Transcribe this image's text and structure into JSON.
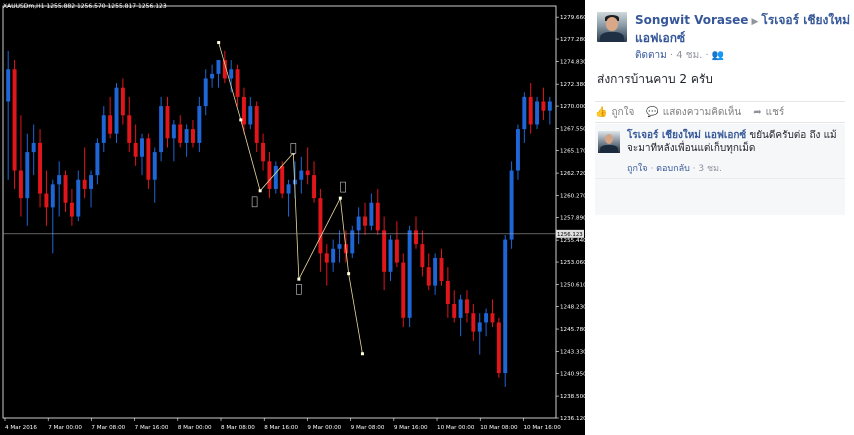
{
  "chart": {
    "header": "XAUUSDm,H1  1255.882 1256.570 1255.817 1256.123",
    "current_price": "1256.123",
    "price_labels": [
      "1279.660",
      "1277.280",
      "1274.830",
      "1272.380",
      "1270.000",
      "1267.550",
      "1265.170",
      "1262.720",
      "1260.270",
      "1257.890",
      "1255.440",
      "1253.060",
      "1250.610",
      "1248.230",
      "1245.780",
      "1243.330",
      "1240.950",
      "1238.500",
      "1236.120"
    ],
    "time_labels": [
      "4 Mar 2016",
      "7 Mar 00:00",
      "7 Mar 08:00",
      "7 Mar 16:00",
      "8 Mar 00:00",
      "8 Mar 08:00",
      "8 Mar 16:00",
      "9 Mar 00:00",
      "9 Mar 08:00",
      "9 Mar 16:00",
      "10 Mar 00:00",
      "10 Mar 08:00",
      "10 Mar 16:00"
    ],
    "colors": {
      "bull": "#1e66d6",
      "bear": "#e0161b",
      "background": "#000000",
      "axis": "#ffffff",
      "zigzag": "#e8d7a0"
    },
    "ylim": [
      1236.12,
      1280.87
    ],
    "candles": [
      [
        1270.5,
        1276.0,
        1262.0,
        1274.0
      ],
      [
        1274.0,
        1275.0,
        1261.0,
        1263.0
      ],
      [
        1263.0,
        1269.0,
        1258.0,
        1260.0
      ],
      [
        1260.0,
        1267.0,
        1257.0,
        1265.0
      ],
      [
        1265.0,
        1268.0,
        1262.5,
        1266.0
      ],
      [
        1266.0,
        1267.5,
        1259.0,
        1260.5
      ],
      [
        1260.5,
        1263.0,
        1257.0,
        1259.0
      ],
      [
        1259.0,
        1262.0,
        1254.0,
        1261.5
      ],
      [
        1261.5,
        1264.0,
        1258.0,
        1262.5
      ],
      [
        1262.5,
        1263.0,
        1258.5,
        1259.5
      ],
      [
        1259.5,
        1261.0,
        1257.0,
        1258.0
      ],
      [
        1258.0,
        1263.0,
        1257.5,
        1262.0
      ],
      [
        1262.0,
        1265.5,
        1260.0,
        1261.0
      ],
      [
        1261.0,
        1263.0,
        1259.0,
        1262.5
      ],
      [
        1262.5,
        1266.5,
        1261.5,
        1266.0
      ],
      [
        1266.0,
        1270.0,
        1265.0,
        1269.0
      ],
      [
        1269.0,
        1271.0,
        1266.5,
        1267.0
      ],
      [
        1267.0,
        1272.5,
        1266.0,
        1272.0
      ],
      [
        1272.0,
        1273.0,
        1268.0,
        1269.0
      ],
      [
        1269.0,
        1271.0,
        1265.0,
        1266.0
      ],
      [
        1266.0,
        1268.0,
        1263.5,
        1264.5
      ],
      [
        1264.5,
        1267.0,
        1262.5,
        1266.5
      ],
      [
        1266.5,
        1267.0,
        1261.0,
        1262.0
      ],
      [
        1262.0,
        1265.5,
        1259.5,
        1265.0
      ],
      [
        1265.0,
        1271.0,
        1264.0,
        1270.0
      ],
      [
        1270.0,
        1271.0,
        1265.5,
        1266.5
      ],
      [
        1266.5,
        1268.5,
        1264.0,
        1268.0
      ],
      [
        1268.0,
        1269.0,
        1265.5,
        1266.0
      ],
      [
        1266.0,
        1268.0,
        1264.5,
        1267.5
      ],
      [
        1267.5,
        1268.5,
        1265.5,
        1266.0
      ],
      [
        1266.0,
        1271.0,
        1265.0,
        1270.0
      ],
      [
        1270.0,
        1274.0,
        1269.0,
        1273.0
      ],
      [
        1273.0,
        1274.5,
        1272.0,
        1273.5
      ],
      [
        1273.5,
        1275.0,
        1272.0,
        1275.0
      ],
      [
        1275.0,
        1276.0,
        1272.5,
        1273.0
      ],
      [
        1273.0,
        1275.0,
        1271.5,
        1274.0
      ],
      [
        1274.0,
        1274.5,
        1270.0,
        1271.0
      ],
      [
        1271.0,
        1272.0,
        1267.0,
        1268.0
      ],
      [
        1268.0,
        1271.0,
        1267.5,
        1270.0
      ],
      [
        1270.0,
        1270.5,
        1265.0,
        1266.0
      ],
      [
        1266.0,
        1267.0,
        1263.0,
        1264.0
      ],
      [
        1264.0,
        1265.0,
        1260.0,
        1261.0
      ],
      [
        1261.0,
        1264.0,
        1260.5,
        1263.5
      ],
      [
        1263.5,
        1264.0,
        1260.0,
        1260.5
      ],
      [
        1260.5,
        1262.0,
        1258.0,
        1261.5
      ],
      [
        1261.5,
        1264.0,
        1260.0,
        1262.0
      ],
      [
        1262.0,
        1264.5,
        1260.5,
        1263.0
      ],
      [
        1263.0,
        1265.5,
        1261.5,
        1262.5
      ],
      [
        1262.5,
        1264.0,
        1259.5,
        1260.0
      ],
      [
        1260.0,
        1261.0,
        1252.0,
        1254.0
      ],
      [
        1254.0,
        1255.0,
        1250.5,
        1253.0
      ],
      [
        1253.0,
        1255.5,
        1252.0,
        1254.5
      ],
      [
        1254.5,
        1256.5,
        1253.0,
        1255.0
      ],
      [
        1255.0,
        1256.5,
        1253.0,
        1254.0
      ],
      [
        1254.0,
        1257.0,
        1253.5,
        1256.5
      ],
      [
        1256.5,
        1259.0,
        1255.0,
        1258.0
      ],
      [
        1258.0,
        1259.5,
        1256.0,
        1257.0
      ],
      [
        1257.0,
        1260.5,
        1256.5,
        1259.5
      ],
      [
        1259.5,
        1261.0,
        1256.0,
        1256.5
      ],
      [
        1256.5,
        1258.0,
        1250.0,
        1252.0
      ],
      [
        1252.0,
        1256.0,
        1251.0,
        1255.5
      ],
      [
        1255.5,
        1257.5,
        1252.5,
        1253.0
      ],
      [
        1253.0,
        1254.0,
        1246.0,
        1247.0
      ],
      [
        1247.0,
        1257.0,
        1246.0,
        1256.5
      ],
      [
        1256.5,
        1258.0,
        1254.5,
        1255.0
      ],
      [
        1255.0,
        1256.5,
        1251.5,
        1252.5
      ],
      [
        1252.5,
        1254.0,
        1250.0,
        1250.5
      ],
      [
        1250.5,
        1254.0,
        1249.5,
        1253.5
      ],
      [
        1253.5,
        1254.5,
        1250.5,
        1251.0
      ],
      [
        1251.0,
        1252.5,
        1247.0,
        1248.5
      ],
      [
        1248.5,
        1250.0,
        1246.5,
        1247.0
      ],
      [
        1247.0,
        1249.5,
        1245.0,
        1249.0
      ],
      [
        1249.0,
        1250.0,
        1246.5,
        1247.5
      ],
      [
        1247.5,
        1248.5,
        1244.5,
        1245.5
      ],
      [
        1245.5,
        1247.5,
        1243.0,
        1246.5
      ],
      [
        1246.5,
        1248.0,
        1245.0,
        1247.5
      ],
      [
        1247.5,
        1249.0,
        1246.0,
        1246.5
      ],
      [
        1246.5,
        1247.0,
        1240.5,
        1241.0
      ],
      [
        1241.0,
        1256.0,
        1239.5,
        1255.5
      ],
      [
        1255.5,
        1264.0,
        1254.5,
        1263.0
      ],
      [
        1263.0,
        1268.0,
        1262.0,
        1267.5
      ],
      [
        1267.5,
        1271.5,
        1266.0,
        1271.0
      ],
      [
        1271.0,
        1272.5,
        1267.0,
        1268.0
      ],
      [
        1268.0,
        1271.0,
        1267.5,
        1270.5
      ],
      [
        1270.5,
        1272.0,
        1268.5,
        1269.5
      ],
      [
        1269.5,
        1271.0,
        1268.0,
        1270.5
      ]
    ],
    "zigzag": [
      {
        "x": 0.39,
        "y": 1276.9
      },
      {
        "x": 0.43,
        "y": 1268.5
      },
      {
        "x": 0.465,
        "y": 1260.8
      },
      {
        "x": 0.525,
        "y": 1264.9
      },
      {
        "x": 0.535,
        "y": 1251.2
      },
      {
        "x": 0.61,
        "y": 1260.0
      },
      {
        "x": 0.625,
        "y": 1251.8
      },
      {
        "x": 0.65,
        "y": 1243.1
      }
    ],
    "markers": [
      {
        "x": 0.455,
        "y": 1259.6
      },
      {
        "x": 0.525,
        "y": 1265.4
      },
      {
        "x": 0.535,
        "y": 1250.1
      },
      {
        "x": 0.615,
        "y": 1261.2
      }
    ]
  },
  "post": {
    "author": "Songwit Vorasee",
    "page": "โรเจอร์ เชียงใหม่ แอฟเอกซ์",
    "follow_label": "ติดตาม",
    "time": "4 ชม.",
    "privacy_icon": "friends-icon",
    "text": "ส่งการบ้านคาบ 2 ครับ",
    "actions": {
      "like": "ถูกใจ",
      "comment": "แสดงความคิดเห็น",
      "share": "แชร์"
    },
    "comment": {
      "author": "โรเจอร์ เชียงใหม่ แอฟเอกซ์",
      "text": "ขยันดีครับต่อ ถึง แม้จะมาทีหลังเพื่อนแต่เก็บทุกเม็ด",
      "like": "ถูกใจ",
      "reply": "ตอบกลับ",
      "time": "3 ชม."
    }
  }
}
